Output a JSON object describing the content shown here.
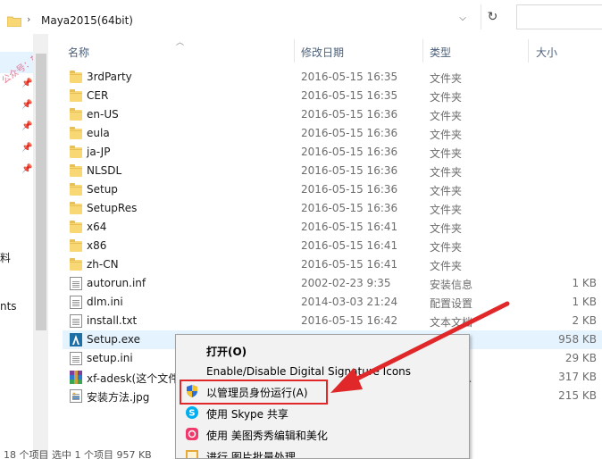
{
  "address_bar": {
    "path": "Maya2015(64bit)",
    "separator": "›",
    "dropdown": "⌵",
    "refresh": "↻"
  },
  "nav": {
    "watermark": "公众号：软件管家",
    "labels": [
      "料",
      "nts"
    ],
    "pin_icon": "pin-icon"
  },
  "columns": {
    "name": "名称",
    "date": "修改日期",
    "type": "类型",
    "size": "大小"
  },
  "files": [
    {
      "name": "3rdParty",
      "date": "2016-05-15 16:35",
      "type": "文件夹",
      "size": "",
      "icon": "folder-icon"
    },
    {
      "name": "CER",
      "date": "2016-05-15 16:35",
      "type": "文件夹",
      "size": "",
      "icon": "folder-icon"
    },
    {
      "name": "en-US",
      "date": "2016-05-15 16:36",
      "type": "文件夹",
      "size": "",
      "icon": "folder-icon"
    },
    {
      "name": "eula",
      "date": "2016-05-15 16:36",
      "type": "文件夹",
      "size": "",
      "icon": "folder-icon"
    },
    {
      "name": "ja-JP",
      "date": "2016-05-15 16:36",
      "type": "文件夹",
      "size": "",
      "icon": "folder-icon"
    },
    {
      "name": "NLSDL",
      "date": "2016-05-15 16:36",
      "type": "文件夹",
      "size": "",
      "icon": "folder-icon"
    },
    {
      "name": "Setup",
      "date": "2016-05-15 16:36",
      "type": "文件夹",
      "size": "",
      "icon": "folder-icon"
    },
    {
      "name": "SetupRes",
      "date": "2016-05-15 16:36",
      "type": "文件夹",
      "size": "",
      "icon": "folder-icon"
    },
    {
      "name": "x64",
      "date": "2016-05-15 16:41",
      "type": "文件夹",
      "size": "",
      "icon": "folder-icon"
    },
    {
      "name": "x86",
      "date": "2016-05-15 16:41",
      "type": "文件夹",
      "size": "",
      "icon": "folder-icon"
    },
    {
      "name": "zh-CN",
      "date": "2016-05-15 16:41",
      "type": "文件夹",
      "size": "",
      "icon": "folder-icon"
    },
    {
      "name": "autorun.inf",
      "date": "2002-02-23 9:35",
      "type": "安装信息",
      "size": "1 KB",
      "icon": "settings-file-icon"
    },
    {
      "name": "dlm.ini",
      "date": "2014-03-03 21:24",
      "type": "配置设置",
      "size": "1 KB",
      "icon": "settings-file-icon"
    },
    {
      "name": "install.txt",
      "date": "2016-05-15 16:42",
      "type": "文本文档",
      "size": "2 KB",
      "icon": "text-file-icon"
    },
    {
      "name": "Setup.exe",
      "date": "",
      "type": "",
      "size": "958 KB",
      "icon": "autodesk-app-icon"
    },
    {
      "name": "setup.ini",
      "date": "",
      "type": "",
      "size": "29 KB",
      "icon": "settings-file-icon"
    },
    {
      "name": "xf-adesk(这个文件",
      "date": "",
      "type": "压缩文...",
      "size": "317 KB",
      "icon": "archive-icon"
    },
    {
      "name": "安装方法.jpg",
      "date": "",
      "type": "",
      "size": "215 KB",
      "icon": "image-file-icon"
    }
  ],
  "context_menu": {
    "items": [
      {
        "label": "打开(O)",
        "icon": ""
      },
      {
        "label": "Enable/Disable Digital Signature Icons",
        "icon": ""
      },
      {
        "label": "以管理员身份运行(A)",
        "icon": "uac-shield-icon"
      },
      {
        "label": "使用 Skype 共享",
        "icon": "skype-icon"
      },
      {
        "label": "使用 美图秀秀编辑和美化",
        "icon": "meitu-icon"
      },
      {
        "label": "进行 图片批量处理",
        "icon": "batch-image-icon"
      }
    ]
  },
  "status_bar": {
    "text": "18 个项目   选中 1 个项目  957 KB"
  },
  "colors": {
    "selection": "#e5f3ff",
    "highlight_red": "#e0282a",
    "folder": "#f8d775"
  }
}
